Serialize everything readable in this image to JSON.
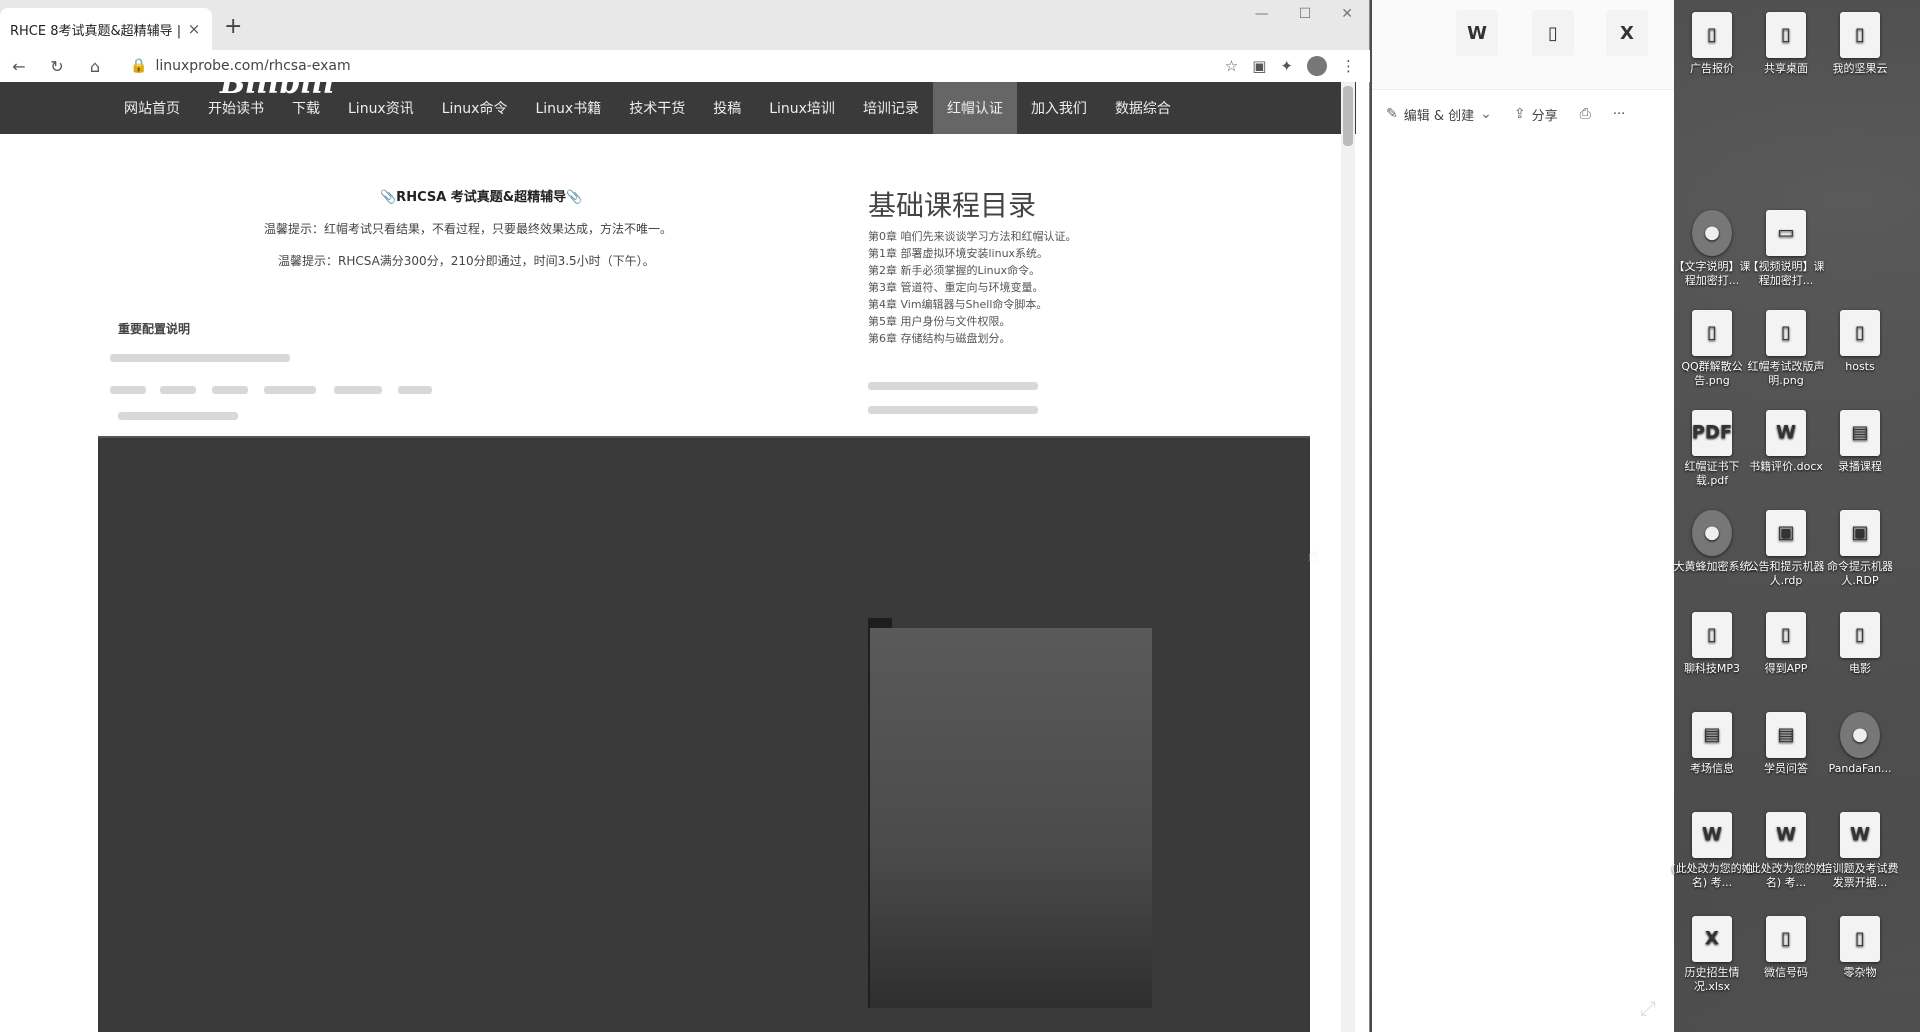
{
  "browser": {
    "tab_title": "RHCE 8考试真题&超精辅导 |",
    "tab_close": "×",
    "new_tab": "+",
    "url": "linuxprobe.com/rhcsa-exam",
    "logo": "Bilibili"
  },
  "site_nav": {
    "items": [
      "网站首页",
      "开始读书",
      "下载",
      "Linux资讯",
      "Linux命令",
      "Linux书籍",
      "技术干货",
      "投稿",
      "Linux培训",
      "培训记录",
      "红帽认证",
      "加入我们",
      "数据综合"
    ],
    "active_index": 10
  },
  "article": {
    "title": "📎RHCSA 考试真题&超精辅导📎",
    "note1": "温馨提示：红帽考试只看结果，不看过程，只要最终效果达成，方法不唯一。",
    "note2": "温馨提示：RHCSA满分300分，210分即通过，时间3.5小时（下午）。",
    "section_label": "重要配置说明"
  },
  "toc": {
    "title": "基础课程目录",
    "items": [
      "第0章 咱们先来谈谈学习方法和红帽认证。",
      "第1章 部署虚拟环境安装linux系统。",
      "第2章 新手必须掌握的Linux命令。",
      "第3章 管道符、重定向与环境变量。",
      "第4章 Vim编辑器与Shell命令脚本。",
      "第5章 用户身份与文件权限。",
      "第6章 存储结构与磁盘划分。"
    ]
  },
  "viewer": {
    "edit_create": "编辑 & 创建",
    "share": "分享",
    "print_icon": "printer-icon",
    "more": "···"
  },
  "desktop_icons": [
    {
      "label": "广告报价",
      "glyph": "▯"
    },
    {
      "label": "共享桌面",
      "glyph": "▯"
    },
    {
      "label": "我的坚果云",
      "glyph": "▯"
    },
    {
      "label": "【文字说明】课程加密打...",
      "glyph": "●"
    },
    {
      "label": "【视频说明】课程加密打...",
      "glyph": "▭"
    },
    {
      "label": "QQ群解散公告.png",
      "glyph": "▯"
    },
    {
      "label": "红帽考试改版声明.png",
      "glyph": "▯"
    },
    {
      "label": "hosts",
      "glyph": "▯"
    },
    {
      "label": "红帽证书下载.pdf",
      "glyph": "PDF"
    },
    {
      "label": "书籍评价.docx",
      "glyph": "W"
    },
    {
      "label": "录播课程",
      "glyph": "▤"
    },
    {
      "label": "大黄蜂加密系统",
      "glyph": "●"
    },
    {
      "label": "公告和提示机器人.rdp",
      "glyph": "▣"
    },
    {
      "label": "命令提示机器人.RDP",
      "glyph": "▣"
    },
    {
      "label": "聊科技MP3",
      "glyph": "▯"
    },
    {
      "label": "得到APP",
      "glyph": "▯"
    },
    {
      "label": "电影",
      "glyph": "▯"
    },
    {
      "label": "考场信息",
      "glyph": "▤"
    },
    {
      "label": "学员问答",
      "glyph": "▤"
    },
    {
      "label": "PandaFan...",
      "glyph": "●"
    },
    {
      "label": "(此处改为您的姓名) 考...",
      "glyph": "W"
    },
    {
      "label": "(此处改为您的姓名) 考...",
      "glyph": "W"
    },
    {
      "label": "培训题及考试费发票开据...",
      "glyph": "W"
    },
    {
      "label": "历史招生情况.xlsx",
      "glyph": "X"
    },
    {
      "label": "微信号码",
      "glyph": "▯"
    },
    {
      "label": "零杂物",
      "glyph": "▯"
    }
  ],
  "top_icons": [
    "W",
    "▯",
    "X"
  ]
}
